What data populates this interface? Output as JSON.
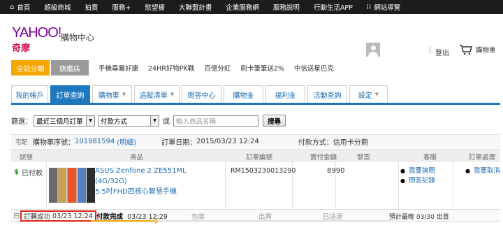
{
  "topnav": {
    "items": [
      "首頁",
      "超級商城",
      "拍賣",
      "服務+",
      "慾望櫥",
      "大聯盟計畫",
      "企業服務網",
      "服務說明",
      "行動生活APP",
      "網站導覽"
    ]
  },
  "header": {
    "logo_text": "YAHOO!",
    "logo_sub": "奇摩",
    "site_name": "購物中心",
    "separator": "|",
    "logout": "登出",
    "cart": "購物車"
  },
  "category_bar": {
    "all": "全站分類",
    "flagship": "旗艦店",
    "links": [
      "手機專屬好康",
      "24HR好物PK戰",
      "百億分紅",
      "刷卡筆筆送2%",
      "中信送星巴克"
    ]
  },
  "tabs": [
    {
      "label": "我的帳戶",
      "caret": false
    },
    {
      "label": "訂單查詢",
      "caret": false,
      "active": true
    },
    {
      "label": "購物車",
      "caret": true
    },
    {
      "label": "追蹤清單",
      "caret": true
    },
    {
      "label": "問答中心",
      "caret": false
    },
    {
      "label": "購物金",
      "caret": false
    },
    {
      "label": "福利金",
      "caret": false
    },
    {
      "label": "活動查詢",
      "caret": false
    },
    {
      "label": "設定",
      "caret": true
    }
  ],
  "filter": {
    "label": "篩選：",
    "period": "最近三個月訂單",
    "payment": "付款方式",
    "or": "或",
    "search_placeholder": "輸入商品名稱",
    "search_button": "搜尋"
  },
  "order": {
    "delivery_badge": "宅配",
    "number_label": "購物車序號：",
    "number": "101981594",
    "detail_link": "(明細)",
    "date_label": "訂單日期：",
    "date": "2015/03/23 12:24",
    "payment_label": "付款方式：",
    "payment": "信用卡分期"
  },
  "columns": [
    "狀態",
    "商品",
    "訂單編號",
    "實付金額",
    "發票",
    "客服",
    "訂單處理"
  ],
  "item": {
    "status": "已付款",
    "product_line1": "ASUS Zenfone 2 ZE551ML (4G/32G)",
    "product_line2": "5.5吋FHD四核心智慧手機",
    "order_no": "RM1503230013290",
    "amount": "8990",
    "service_links": [
      "我要詢問",
      "問答記錄"
    ],
    "actions": [
      "我要取消"
    ]
  },
  "timeline": {
    "step1": "訂購成功",
    "step1_time": "03/23 12:24",
    "step2": "付款完成",
    "step2_time": "03/23 12:29",
    "step3": "包裝",
    "step4": "出貨",
    "step5": "已送達",
    "eta_label": "預計最晚",
    "eta": "03/30 出貨"
  },
  "colors": {
    "tab_blue": "#1e78c0",
    "orange": "#f6a600",
    "alert_red": "#e0251b"
  }
}
